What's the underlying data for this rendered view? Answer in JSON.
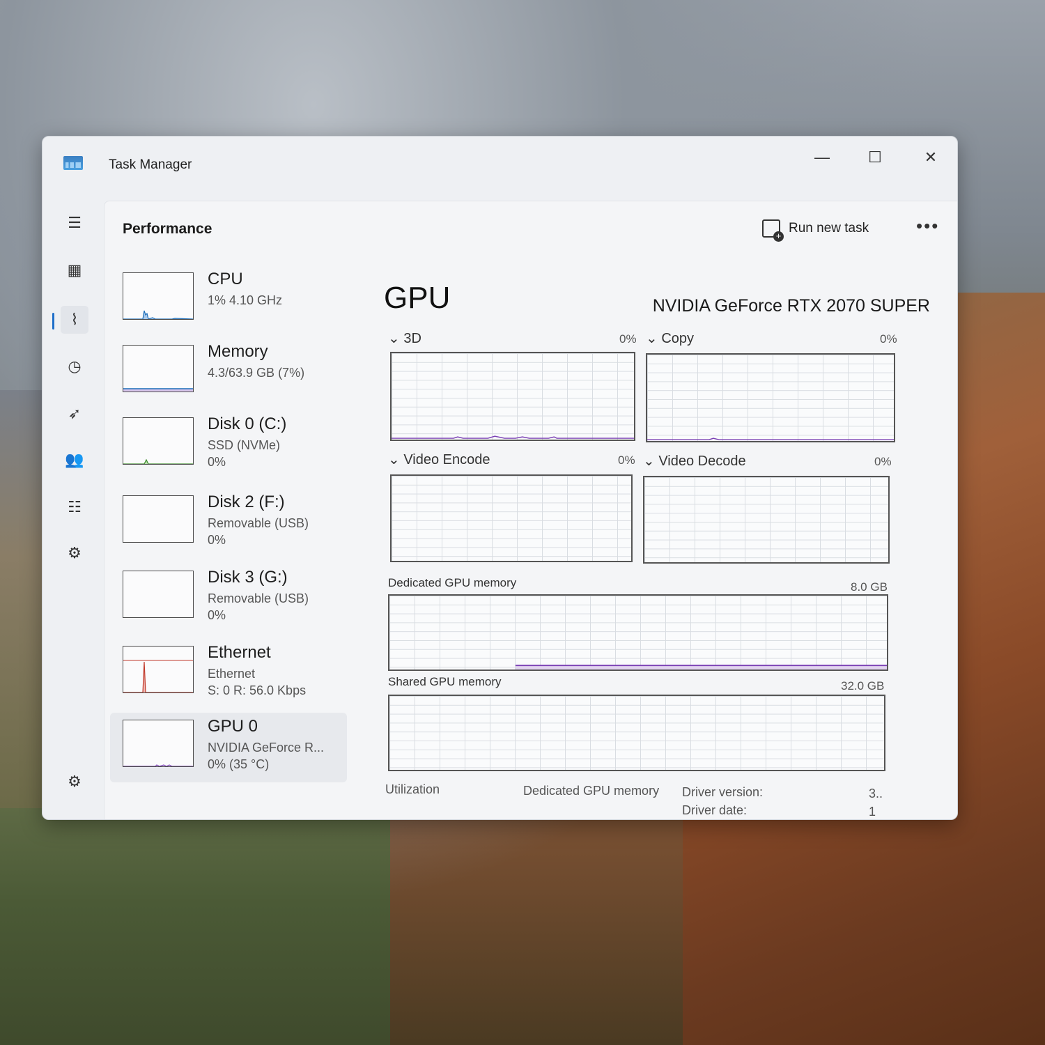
{
  "window": {
    "title": "Task Manager",
    "controls": {
      "minimize": "—",
      "maximize": "☐",
      "close": "✕"
    }
  },
  "nav": [
    {
      "name": "hamburger-menu-icon",
      "glyph": "☰"
    },
    {
      "name": "processes-icon",
      "glyph": "▦"
    },
    {
      "name": "performance-icon",
      "glyph": "⌇",
      "active": true
    },
    {
      "name": "app-history-icon",
      "glyph": "◷"
    },
    {
      "name": "startup-apps-icon",
      "glyph": "➶"
    },
    {
      "name": "users-icon",
      "glyph": "👥"
    },
    {
      "name": "details-icon",
      "glyph": "☷"
    },
    {
      "name": "services-icon",
      "glyph": "⚙"
    },
    {
      "name": "settings-icon",
      "glyph": "⚙"
    }
  ],
  "header": {
    "title": "Performance",
    "run_new_task": "Run new task",
    "more": "•••"
  },
  "devices": [
    {
      "name": "CPU",
      "sub1": "1% 4.10 GHz",
      "sub2": "",
      "color": "#1b6cb8",
      "selected": false
    },
    {
      "name": "Memory",
      "sub1": "4.3/63.9 GB (7%)",
      "sub2": "",
      "color": "#7a3fb4",
      "selected": false
    },
    {
      "name": "Disk 0 (C:)",
      "sub1": "SSD (NVMe)",
      "sub2": "0%",
      "color": "#3c8a2c",
      "selected": false
    },
    {
      "name": "Disk 2 (F:)",
      "sub1": "Removable (USB)",
      "sub2": "0%",
      "color": "#3c8a2c",
      "selected": false
    },
    {
      "name": "Disk 3 (G:)",
      "sub1": "Removable (USB)",
      "sub2": "0%",
      "color": "#3c8a2c",
      "selected": false
    },
    {
      "name": "Ethernet",
      "sub1": "Ethernet",
      "sub2": "S: 0 R: 56.0 Kbps",
      "color": "#c0392b",
      "selected": false
    },
    {
      "name": "GPU 0",
      "sub1": "NVIDIA GeForce R...",
      "sub2": "0% (35 °C)",
      "color": "#7a3fb4",
      "selected": true
    }
  ],
  "gpu": {
    "title": "GPU",
    "model": "NVIDIA GeForce RTX 2070 SUPER",
    "engines": [
      {
        "label": "3D",
        "pct": "0%"
      },
      {
        "label": "Copy",
        "pct": "0%"
      },
      {
        "label": "Video Encode",
        "pct": "0%"
      },
      {
        "label": "Video Decode",
        "pct": "0%"
      }
    ],
    "dedicated_label": "Dedicated GPU memory",
    "dedicated_max": "8.0 GB",
    "shared_label": "Shared GPU memory",
    "shared_max": "32.0 GB",
    "stats": {
      "utilization_label": "Utilization",
      "dedicated_label": "Dedicated GPU memory",
      "driver_version_label": "Driver version:",
      "driver_version_value": "3..",
      "driver_date_label": "Driver date:",
      "driver_date_value": "1"
    }
  },
  "colors": {
    "accent": "#1f6fc9",
    "gpu_line": "#7a3fb4"
  }
}
